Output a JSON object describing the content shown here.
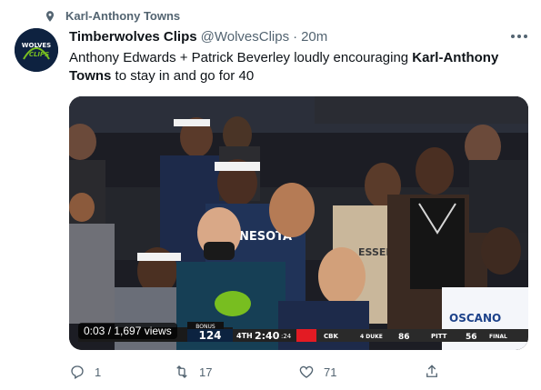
{
  "context": {
    "label": "Karl-Anthony Towns"
  },
  "tweet": {
    "author_name": "Timberwolves Clips",
    "handle": "@WolvesClips",
    "separator": "·",
    "time": "20m",
    "text_part1": "Anthony Edwards + Patrick Beverley loudly encouraging ",
    "text_bold": "Karl-Anthony Towns",
    "text_part2": " to stay in and go for 40"
  },
  "avatar": {
    "line1": "WOLVES",
    "line2": "CLIPS"
  },
  "video": {
    "timer": "0:03 / 1,697 views",
    "scoreboard": {
      "bonus_label": "BONUS",
      "home_score": "124",
      "period": "4TH",
      "clock": "2:40",
      "shot_clock": ":24",
      "ticker_1_team": "CBK",
      "ticker_1_match": "4 DUKE",
      "ticker_1_score": "86",
      "ticker_2_team": "PITT",
      "ticker_2_score": "56",
      "ticker_status": "FINAL"
    },
    "jersey_text": "NESOTA",
    "jersey2_text": "OSCANO",
    "sweatshirt_text": "ESSEN"
  },
  "actions": {
    "reply_count": "1",
    "retweet_count": "17",
    "like_count": "71"
  },
  "colors": {
    "accent": "#1d9bf0",
    "muted": "#536471",
    "text": "#0f1419"
  }
}
